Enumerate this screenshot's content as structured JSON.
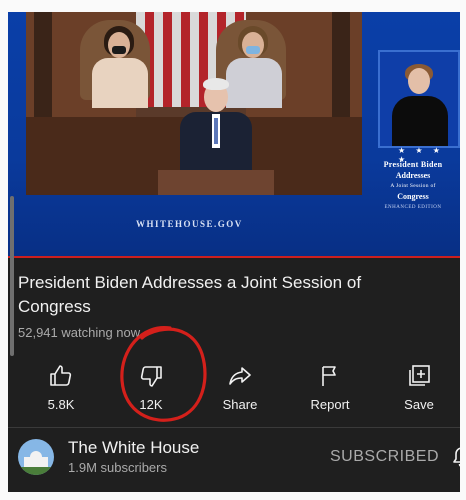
{
  "video": {
    "website": "WHITEHOUSE.GOV",
    "overlay": {
      "stars": "★ ★ ★ ★",
      "line1": "President Biden",
      "line2": "Addresses",
      "line3": "A Joint Session of",
      "line4": "Congress",
      "line5": "ENHANCED EDITION"
    }
  },
  "title": "President Biden Addresses a Joint Session of Congress",
  "watching": "52,941 watching now",
  "actions": [
    {
      "icon": "thumbs-up-icon",
      "label": "5.8K"
    },
    {
      "icon": "thumbs-down-icon",
      "label": "12K"
    },
    {
      "icon": "share-icon",
      "label": "Share"
    },
    {
      "icon": "flag-icon",
      "label": "Report"
    },
    {
      "icon": "save-playlist-icon",
      "label": "Save"
    }
  ],
  "channel": {
    "name": "The White House",
    "subscribers": "1.9M subscribers",
    "subscribe_label": "SUBSCRIBED"
  },
  "colors": {
    "background": "#1f1f1f",
    "player_blue": "#0a3fa8",
    "annotation_red": "#d4201b"
  }
}
